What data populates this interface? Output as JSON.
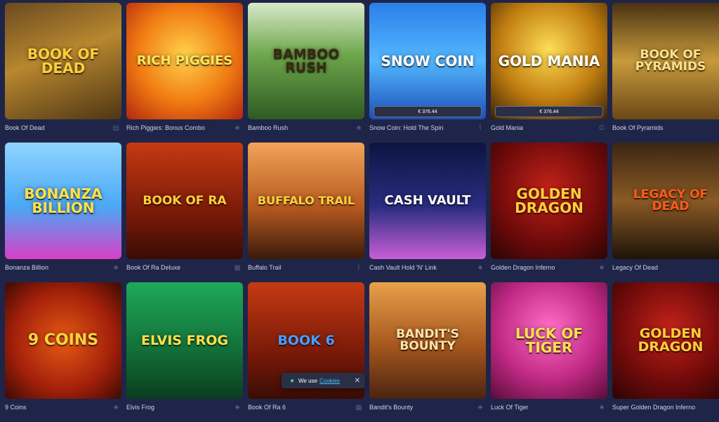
{
  "games": [
    {
      "name": "Book Of Dead",
      "art": "BOOK OF DEAD",
      "provider_icon": "book-icon",
      "bg": "linear-gradient(160deg,#6a4a20,#b8872f 45%,#4d3514)",
      "fg": "#ffcf3a",
      "size": "20px"
    },
    {
      "name": "Rich Piggies: Bonus Combo",
      "art": "RICH PIGGIES",
      "provider_icon": "clover-icon",
      "bg": "radial-gradient(circle at 50% 45%,#ffd24a,#f07a12 55%,#b3260d)",
      "fg": "#ffe45c",
      "size": "18px"
    },
    {
      "name": "Bamboo Rush",
      "art": "BAMBOO RUSH",
      "provider_icon": "clover-icon",
      "bg": "linear-gradient(180deg,#d8e9c9,#6da64b 45%,#2e5a24)",
      "fg": "#3b2a12",
      "size": "19px"
    },
    {
      "name": "Snow Coin: Hold The Spin",
      "art": "SNOW COIN",
      "provider_icon": "mic-icon",
      "bg": "linear-gradient(180deg,#2b7fe8,#53b7ff 50%,#1c4fb8)",
      "fg": "#ffffff",
      "size": "20px",
      "jackpot": "€ 376.44"
    },
    {
      "name": "Gold Mania",
      "art": "GOLD MANIA",
      "provider_icon": "g-icon",
      "bg": "radial-gradient(circle at 50% 40%,#ffdd55,#c07d10 55%,#3a2306)",
      "fg": "#ffffff",
      "size": "20px",
      "jackpot": "€ 376.44"
    },
    {
      "name": "Book Of Pyramids",
      "art": "BOOK OF PYRAMIDS",
      "provider_icon": "g-icon",
      "bg": "linear-gradient(180deg,#4a3212,#c79b3c 50%,#6b4817)",
      "fg": "#ffe18a",
      "size": "17px"
    },
    {
      "name": "Bonanza Billion",
      "art": "BONANZA BILLION",
      "provider_icon": "clover-icon",
      "bg": "linear-gradient(180deg,#8fd4ff,#4aa8f5 55%,#d93fc7)",
      "fg": "#ffe04a",
      "size": "20px"
    },
    {
      "name": "Book Of Ra Deluxe",
      "art": "BOOK OF RA",
      "provider_icon": "calc-icon",
      "bg": "linear-gradient(180deg,#c53a12,#7a1a08 60%,#3a0c04)",
      "fg": "#ffcf3a",
      "size": "17px"
    },
    {
      "name": "Buffalo Trail",
      "art": "BUFFALO TRAIL",
      "provider_icon": "mic-icon",
      "bg": "linear-gradient(180deg,#f2a35a,#b75a1f 55%,#3a1b0a)",
      "fg": "#ffd23d",
      "size": "16px"
    },
    {
      "name": "Cash Vault Hold 'N' Link",
      "art": "CASH VAULT",
      "provider_icon": "clover-icon",
      "bg": "linear-gradient(180deg,#0b1540,#2a2d82 55%,#c85fd8)",
      "fg": "#ffffff",
      "size": "18px"
    },
    {
      "name": "Golden Dragon Inferno",
      "art": "GOLDEN DRAGON",
      "provider_icon": "clover-icon",
      "bg": "radial-gradient(circle at 50% 40%,#c4221a,#6e0a0a 60%,#2b0404)",
      "fg": "#ffcf3a",
      "size": "20px"
    },
    {
      "name": "Legacy Of Dead",
      "art": "LEGACY OF DEAD",
      "provider_icon": "book-icon",
      "bg": "linear-gradient(180deg,#3b2614,#8a5a24 50%,#1e1309)",
      "fg": "#ff5a1a",
      "size": "17px"
    },
    {
      "name": "9 Coins",
      "art": "9 COINS",
      "provider_icon": "clover-icon",
      "bg": "radial-gradient(circle at 50% 50%,#e65a14,#a3200a 60%,#3c0a04)",
      "fg": "#ffd23d",
      "size": "22px"
    },
    {
      "name": "Elvis Frog",
      "art": "ELVIS FROG",
      "provider_icon": "clover-icon",
      "bg": "linear-gradient(180deg,#1fa85a,#13733a 55%,#0a3d1f)",
      "fg": "#ffe04a",
      "size": "19px"
    },
    {
      "name": "Book Of Ra 6",
      "art": "BOOK 6",
      "provider_icon": "calc-icon",
      "bg": "linear-gradient(180deg,#c53a12,#7a1a08 60%,#3a0c04)",
      "fg": "#4a9cff",
      "size": "19px"
    },
    {
      "name": "Bandit's Bounty",
      "art": "BANDIT'S BOUNTY",
      "provider_icon": "clover-icon",
      "bg": "linear-gradient(180deg,#e8a04a,#a5561e 55%,#4a2410)",
      "fg": "#ffe2a8",
      "size": "17px"
    },
    {
      "name": "Luck Of Tiger",
      "art": "LUCK OF TIGER",
      "provider_icon": "clover-icon",
      "bg": "radial-gradient(circle at 50% 40%,#ff6fc7,#c22a86 55%,#5a0c3a)",
      "fg": "#ffe04a",
      "size": "20px"
    },
    {
      "name": "Super Golden Dragon Inferno",
      "art": "GOLDEN DRAGON",
      "provider_icon": "clover-icon",
      "bg": "radial-gradient(circle at 50% 40%,#c4221a,#6e0a0a 60%,#2b0404)",
      "fg": "#ffcf3a",
      "size": "19px"
    }
  ],
  "cookie": {
    "text": "We use",
    "link": "Cookies",
    "close": "✕"
  }
}
